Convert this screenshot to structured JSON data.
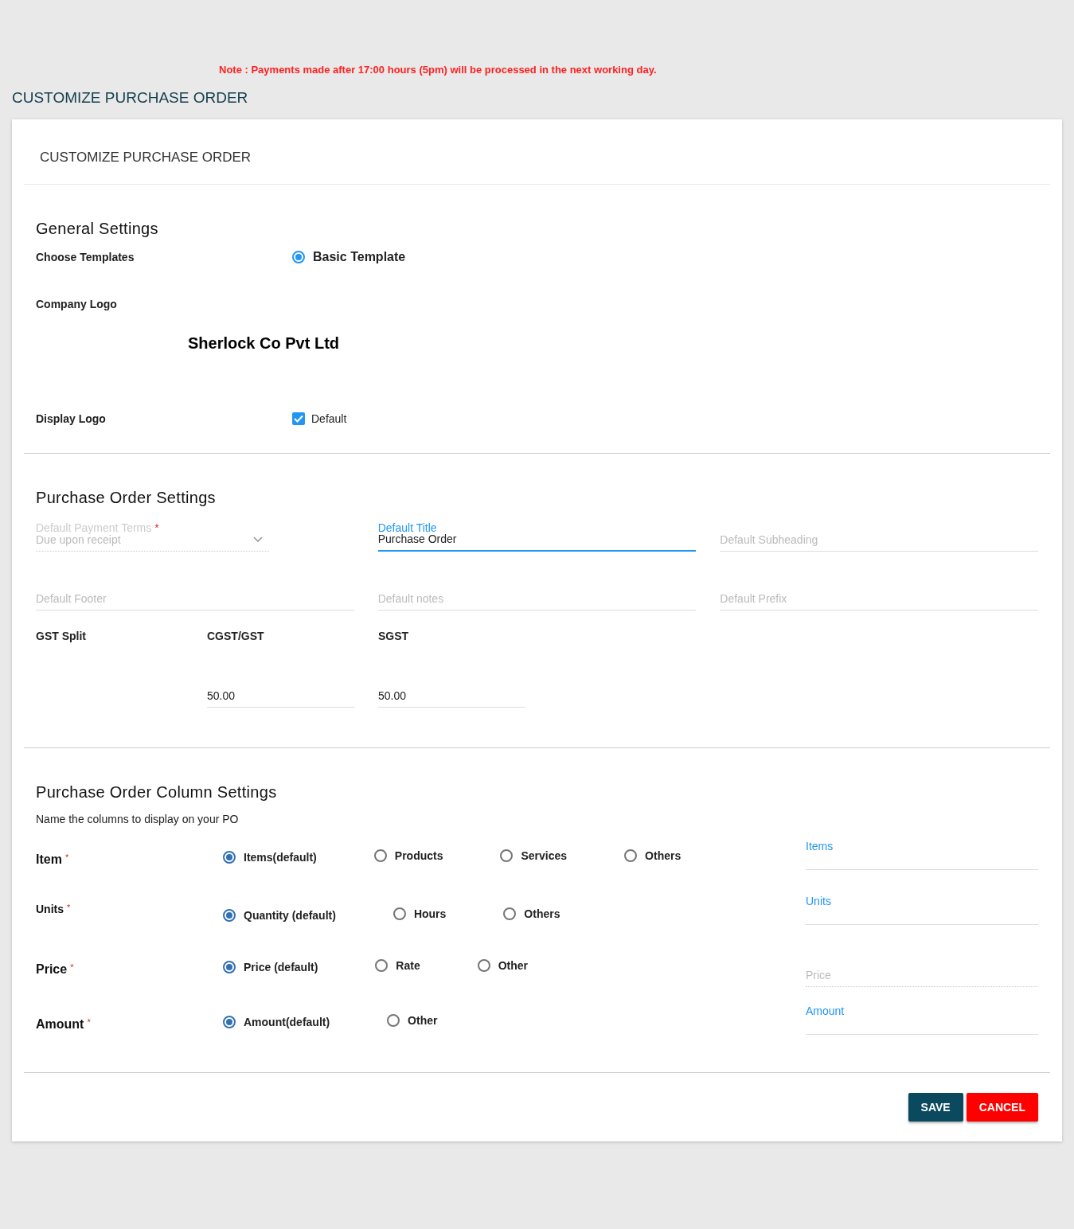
{
  "note": "Note : Payments made after 17:00 hours (5pm) will be processed in the next working day.",
  "page_title": "CUSTOMIZE PURCHASE ORDER",
  "card": {
    "title": "CUSTOMIZE PURCHASE ORDER",
    "general": {
      "heading": "General Settings",
      "template_label": "Choose Templates",
      "templates": [
        {
          "label": "Basic Template",
          "selected": true
        }
      ],
      "logo_label": "Company Logo",
      "logo_text": "Sherlock Co Pvt Ltd",
      "display_logo_label": "Display Logo",
      "display_logo": {
        "label": "Default",
        "checked": true
      }
    },
    "po_settings": {
      "heading": "Purchase Order Settings",
      "fields": [
        {
          "kind": "select",
          "label": "Default Payment Terms",
          "required_mark": "*",
          "value": "Due upon receipt",
          "disabled": true
        },
        {
          "kind": "text",
          "label": "Default Title",
          "value": "Purchase Order",
          "focused": true
        },
        {
          "kind": "text",
          "placeholder": "Default Subheading"
        },
        {
          "kind": "text",
          "placeholder": "Default Footer"
        },
        {
          "kind": "text",
          "placeholder": "Default notes"
        },
        {
          "kind": "text",
          "placeholder": "Default Prefix"
        }
      ],
      "gst": {
        "label": "GST Split",
        "columns": [
          {
            "label": "CGST/GST",
            "value": "50.00"
          },
          {
            "label": "SGST",
            "value": "50.00"
          }
        ]
      }
    },
    "column_settings": {
      "heading": "Purchase Order Column Settings",
      "hint": "Name the columns to display on your PO",
      "rows": [
        {
          "label": "Item",
          "required_mark": "*",
          "options": [
            {
              "label": "Items(default)",
              "selected": true
            },
            {
              "label": "Products",
              "selected": false
            },
            {
              "label": "Services",
              "selected": false
            },
            {
              "label": "Others",
              "selected": false
            }
          ],
          "field": {
            "kind": "text",
            "label": "Items"
          }
        },
        {
          "label": "Units",
          "required_mark": "*",
          "options": [
            {
              "label": "Quantity (default)",
              "selected": true
            },
            {
              "label": "Hours",
              "selected": false
            },
            {
              "label": "Others",
              "selected": false
            }
          ],
          "field": {
            "kind": "text",
            "label": "Units"
          }
        },
        {
          "label": "Price",
          "required_mark": "*",
          "options": [
            {
              "label": "Price (default)",
              "selected": true
            },
            {
              "label": "Rate",
              "selected": false
            },
            {
              "label": "Other",
              "selected": false
            }
          ],
          "field": {
            "kind": "text",
            "placeholder": "Price",
            "disabled": true
          }
        },
        {
          "label": "Amount",
          "required_mark": "*",
          "options": [
            {
              "label": "Amount(default)",
              "selected": true
            },
            {
              "label": "Other",
              "selected": false
            }
          ],
          "field": {
            "kind": "text",
            "label": "Amount"
          }
        }
      ]
    },
    "buttons": [
      {
        "kind": "save",
        "label": "SAVE"
      },
      {
        "kind": "cancel",
        "label": "CANCEL"
      }
    ]
  }
}
